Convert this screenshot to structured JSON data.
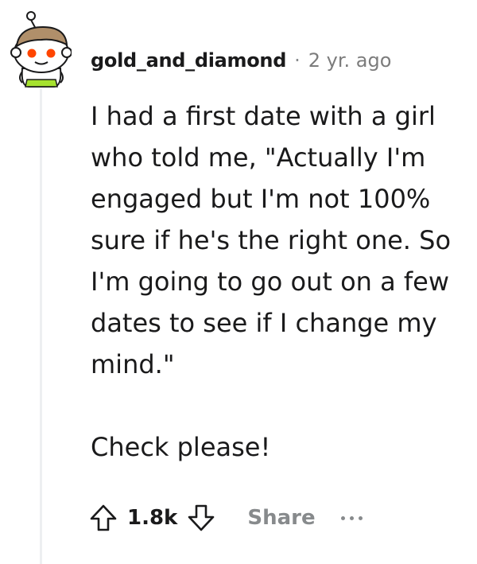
{
  "comment": {
    "username": "gold_and_diamond",
    "separator": "·",
    "age": "2 yr. ago",
    "paragraphs": [
      "I had a first date with a girl who told me, \"Actually I'm engaged but I'm not 100% sure if he's the right one. So I'm going to go out on a few dates to see if I change my mind.\"",
      "Check please!"
    ],
    "score": "1.8k",
    "share_label": "Share"
  },
  "icons": {
    "avatar": "reddit-snoo-avatar",
    "upvote": "upvote-arrow-icon",
    "downvote": "downvote-arrow-icon",
    "more": "more-options-icon"
  },
  "colors": {
    "text": "#1a1a1b",
    "muted": "#878a8c",
    "thread_line": "#edeff1",
    "avatar_eyes": "#ff4500",
    "avatar_hat": "#b08f6a",
    "avatar_shirt": "#a6e22e"
  }
}
